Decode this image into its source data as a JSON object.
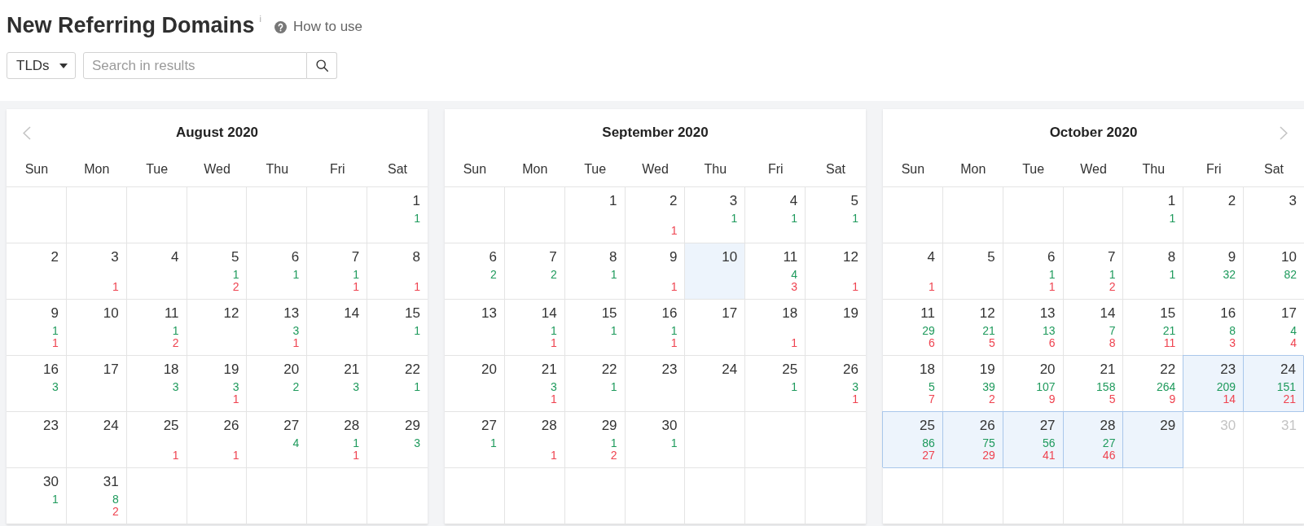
{
  "header": {
    "title": "New Referring Domains",
    "info_mark": "i",
    "help_link": "How to use"
  },
  "toolbar": {
    "filter_dropdown": "TLDs",
    "search": {
      "placeholder": "Search in results"
    }
  },
  "months": [
    {
      "title": "August 2020",
      "prev_arrow": true,
      "next_arrow": false,
      "weekdays": [
        "Sun",
        "Mon",
        "Tue",
        "Wed",
        "Thu",
        "Fri",
        "Sat"
      ],
      "weeks": [
        [
          {
            "kind": "blank"
          },
          {
            "kind": "blank"
          },
          {
            "kind": "blank"
          },
          {
            "kind": "blank"
          },
          {
            "kind": "blank"
          },
          {
            "kind": "blank"
          },
          {
            "kind": "day",
            "day": "1",
            "new": "1",
            "selected": false,
            "highlighted": false,
            "disabled": false
          }
        ],
        [
          {
            "kind": "day",
            "day": "2",
            "selected": false,
            "highlighted": false,
            "disabled": false
          },
          {
            "kind": "day",
            "day": "3",
            "lost": "1",
            "selected": false,
            "highlighted": false,
            "disabled": false
          },
          {
            "kind": "day",
            "day": "4",
            "selected": false,
            "highlighted": false,
            "disabled": false
          },
          {
            "kind": "day",
            "day": "5",
            "new": "1",
            "lost": "2",
            "selected": false,
            "highlighted": false,
            "disabled": false
          },
          {
            "kind": "day",
            "day": "6",
            "new": "1",
            "selected": false,
            "highlighted": false,
            "disabled": false
          },
          {
            "kind": "day",
            "day": "7",
            "new": "1",
            "lost": "1",
            "selected": false,
            "highlighted": false,
            "disabled": false
          },
          {
            "kind": "day",
            "day": "8",
            "lost": "1",
            "selected": false,
            "highlighted": false,
            "disabled": false
          }
        ],
        [
          {
            "kind": "day",
            "day": "9",
            "new": "1",
            "lost": "1",
            "selected": false,
            "highlighted": false,
            "disabled": false
          },
          {
            "kind": "day",
            "day": "10",
            "selected": false,
            "highlighted": false,
            "disabled": false
          },
          {
            "kind": "day",
            "day": "11",
            "new": "1",
            "lost": "2",
            "selected": false,
            "highlighted": false,
            "disabled": false
          },
          {
            "kind": "day",
            "day": "12",
            "selected": false,
            "highlighted": false,
            "disabled": false
          },
          {
            "kind": "day",
            "day": "13",
            "new": "3",
            "lost": "1",
            "selected": false,
            "highlighted": false,
            "disabled": false
          },
          {
            "kind": "day",
            "day": "14",
            "selected": false,
            "highlighted": false,
            "disabled": false
          },
          {
            "kind": "day",
            "day": "15",
            "new": "1",
            "selected": false,
            "highlighted": false,
            "disabled": false
          }
        ],
        [
          {
            "kind": "day",
            "day": "16",
            "new": "3",
            "selected": false,
            "highlighted": false,
            "disabled": false
          },
          {
            "kind": "day",
            "day": "17",
            "selected": false,
            "highlighted": false,
            "disabled": false
          },
          {
            "kind": "day",
            "day": "18",
            "new": "3",
            "selected": false,
            "highlighted": false,
            "disabled": false
          },
          {
            "kind": "day",
            "day": "19",
            "new": "3",
            "lost": "1",
            "selected": false,
            "highlighted": false,
            "disabled": false
          },
          {
            "kind": "day",
            "day": "20",
            "new": "2",
            "selected": false,
            "highlighted": false,
            "disabled": false
          },
          {
            "kind": "day",
            "day": "21",
            "new": "3",
            "selected": false,
            "highlighted": false,
            "disabled": false
          },
          {
            "kind": "day",
            "day": "22",
            "new": "1",
            "selected": false,
            "highlighted": false,
            "disabled": false
          }
        ],
        [
          {
            "kind": "day",
            "day": "23",
            "selected": false,
            "highlighted": false,
            "disabled": false
          },
          {
            "kind": "day",
            "day": "24",
            "selected": false,
            "highlighted": false,
            "disabled": false
          },
          {
            "kind": "day",
            "day": "25",
            "lost": "1",
            "selected": false,
            "highlighted": false,
            "disabled": false
          },
          {
            "kind": "day",
            "day": "26",
            "lost": "1",
            "selected": false,
            "highlighted": false,
            "disabled": false
          },
          {
            "kind": "day",
            "day": "27",
            "new": "4",
            "selected": false,
            "highlighted": false,
            "disabled": false
          },
          {
            "kind": "day",
            "day": "28",
            "new": "1",
            "lost": "1",
            "selected": false,
            "highlighted": false,
            "disabled": false
          },
          {
            "kind": "day",
            "day": "29",
            "new": "3",
            "selected": false,
            "highlighted": false,
            "disabled": false
          }
        ],
        [
          {
            "kind": "day",
            "day": "30",
            "new": "1",
            "selected": false,
            "highlighted": false,
            "disabled": false
          },
          {
            "kind": "day",
            "day": "31",
            "new": "8",
            "lost": "2",
            "selected": false,
            "highlighted": false,
            "disabled": false
          },
          {
            "kind": "blank"
          },
          {
            "kind": "blank"
          },
          {
            "kind": "blank"
          },
          {
            "kind": "blank"
          },
          {
            "kind": "blank"
          }
        ]
      ]
    },
    {
      "title": "September 2020",
      "prev_arrow": false,
      "next_arrow": false,
      "weekdays": [
        "Sun",
        "Mon",
        "Tue",
        "Wed",
        "Thu",
        "Fri",
        "Sat"
      ],
      "weeks": [
        [
          {
            "kind": "blank"
          },
          {
            "kind": "blank"
          },
          {
            "kind": "day",
            "day": "1",
            "selected": false,
            "highlighted": false,
            "disabled": false
          },
          {
            "kind": "day",
            "day": "2",
            "lost": "1",
            "selected": false,
            "highlighted": false,
            "disabled": false
          },
          {
            "kind": "day",
            "day": "3",
            "new": "1",
            "selected": false,
            "highlighted": false,
            "disabled": false
          },
          {
            "kind": "day",
            "day": "4",
            "new": "1",
            "selected": false,
            "highlighted": false,
            "disabled": false
          },
          {
            "kind": "day",
            "day": "5",
            "new": "1",
            "selected": false,
            "highlighted": false,
            "disabled": false
          }
        ],
        [
          {
            "kind": "day",
            "day": "6",
            "new": "2",
            "selected": false,
            "highlighted": false,
            "disabled": false
          },
          {
            "kind": "day",
            "day": "7",
            "new": "2",
            "selected": false,
            "highlighted": false,
            "disabled": false
          },
          {
            "kind": "day",
            "day": "8",
            "new": "1",
            "selected": false,
            "highlighted": false,
            "disabled": false
          },
          {
            "kind": "day",
            "day": "9",
            "lost": "1",
            "selected": false,
            "highlighted": false,
            "disabled": false
          },
          {
            "kind": "day",
            "day": "10",
            "selected": false,
            "highlighted": true,
            "disabled": false
          },
          {
            "kind": "day",
            "day": "11",
            "new": "4",
            "lost": "3",
            "selected": false,
            "highlighted": false,
            "disabled": false
          },
          {
            "kind": "day",
            "day": "12",
            "lost": "1",
            "selected": false,
            "highlighted": false,
            "disabled": false
          }
        ],
        [
          {
            "kind": "day",
            "day": "13",
            "selected": false,
            "highlighted": false,
            "disabled": false
          },
          {
            "kind": "day",
            "day": "14",
            "new": "1",
            "lost": "1",
            "selected": false,
            "highlighted": false,
            "disabled": false
          },
          {
            "kind": "day",
            "day": "15",
            "new": "1",
            "selected": false,
            "highlighted": false,
            "disabled": false
          },
          {
            "kind": "day",
            "day": "16",
            "new": "1",
            "lost": "1",
            "selected": false,
            "highlighted": false,
            "disabled": false
          },
          {
            "kind": "day",
            "day": "17",
            "selected": false,
            "highlighted": false,
            "disabled": false
          },
          {
            "kind": "day",
            "day": "18",
            "lost": "1",
            "selected": false,
            "highlighted": false,
            "disabled": false
          },
          {
            "kind": "day",
            "day": "19",
            "selected": false,
            "highlighted": false,
            "disabled": false
          }
        ],
        [
          {
            "kind": "day",
            "day": "20",
            "selected": false,
            "highlighted": false,
            "disabled": false
          },
          {
            "kind": "day",
            "day": "21",
            "new": "3",
            "lost": "1",
            "selected": false,
            "highlighted": false,
            "disabled": false
          },
          {
            "kind": "day",
            "day": "22",
            "new": "1",
            "selected": false,
            "highlighted": false,
            "disabled": false
          },
          {
            "kind": "day",
            "day": "23",
            "selected": false,
            "highlighted": false,
            "disabled": false
          },
          {
            "kind": "day",
            "day": "24",
            "selected": false,
            "highlighted": false,
            "disabled": false
          },
          {
            "kind": "day",
            "day": "25",
            "new": "1",
            "selected": false,
            "highlighted": false,
            "disabled": false
          },
          {
            "kind": "day",
            "day": "26",
            "new": "3",
            "lost": "1",
            "selected": false,
            "highlighted": false,
            "disabled": false
          }
        ],
        [
          {
            "kind": "day",
            "day": "27",
            "new": "1",
            "selected": false,
            "highlighted": false,
            "disabled": false
          },
          {
            "kind": "day",
            "day": "28",
            "lost": "1",
            "selected": false,
            "highlighted": false,
            "disabled": false
          },
          {
            "kind": "day",
            "day": "29",
            "new": "1",
            "lost": "2",
            "selected": false,
            "highlighted": false,
            "disabled": false
          },
          {
            "kind": "day",
            "day": "30",
            "new": "1",
            "selected": false,
            "highlighted": false,
            "disabled": false
          },
          {
            "kind": "blank"
          },
          {
            "kind": "blank"
          },
          {
            "kind": "blank"
          }
        ],
        [
          {
            "kind": "blank"
          },
          {
            "kind": "blank"
          },
          {
            "kind": "blank"
          },
          {
            "kind": "blank"
          },
          {
            "kind": "blank"
          },
          {
            "kind": "blank"
          },
          {
            "kind": "blank"
          }
        ]
      ]
    },
    {
      "title": "October 2020",
      "prev_arrow": false,
      "next_arrow": true,
      "weekdays": [
        "Sun",
        "Mon",
        "Tue",
        "Wed",
        "Thu",
        "Fri",
        "Sat"
      ],
      "weeks": [
        [
          {
            "kind": "blank"
          },
          {
            "kind": "blank"
          },
          {
            "kind": "blank"
          },
          {
            "kind": "blank"
          },
          {
            "kind": "day",
            "day": "1",
            "new": "1",
            "selected": false,
            "highlighted": false,
            "disabled": false
          },
          {
            "kind": "day",
            "day": "2",
            "selected": false,
            "highlighted": false,
            "disabled": false
          },
          {
            "kind": "day",
            "day": "3",
            "selected": false,
            "highlighted": false,
            "disabled": false
          }
        ],
        [
          {
            "kind": "day",
            "day": "4",
            "lost": "1",
            "selected": false,
            "highlighted": false,
            "disabled": false
          },
          {
            "kind": "day",
            "day": "5",
            "selected": false,
            "highlighted": false,
            "disabled": false
          },
          {
            "kind": "day",
            "day": "6",
            "new": "1",
            "lost": "1",
            "selected": false,
            "highlighted": false,
            "disabled": false
          },
          {
            "kind": "day",
            "day": "7",
            "new": "1",
            "lost": "2",
            "selected": false,
            "highlighted": false,
            "disabled": false
          },
          {
            "kind": "day",
            "day": "8",
            "new": "1",
            "selected": false,
            "highlighted": false,
            "disabled": false
          },
          {
            "kind": "day",
            "day": "9",
            "new": "32",
            "selected": false,
            "highlighted": false,
            "disabled": false
          },
          {
            "kind": "day",
            "day": "10",
            "new": "82",
            "selected": false,
            "highlighted": false,
            "disabled": false
          }
        ],
        [
          {
            "kind": "day",
            "day": "11",
            "new": "29",
            "lost": "6",
            "selected": false,
            "highlighted": false,
            "disabled": false
          },
          {
            "kind": "day",
            "day": "12",
            "new": "21",
            "lost": "5",
            "selected": false,
            "highlighted": false,
            "disabled": false
          },
          {
            "kind": "day",
            "day": "13",
            "new": "13",
            "lost": "6",
            "selected": false,
            "highlighted": false,
            "disabled": false
          },
          {
            "kind": "day",
            "day": "14",
            "new": "7",
            "lost": "8",
            "selected": false,
            "highlighted": false,
            "disabled": false
          },
          {
            "kind": "day",
            "day": "15",
            "new": "21",
            "lost": "11",
            "selected": false,
            "highlighted": false,
            "disabled": false
          },
          {
            "kind": "day",
            "day": "16",
            "new": "8",
            "lost": "3",
            "selected": false,
            "highlighted": false,
            "disabled": false
          },
          {
            "kind": "day",
            "day": "17",
            "new": "4",
            "lost": "4",
            "selected": false,
            "highlighted": false,
            "disabled": false
          }
        ],
        [
          {
            "kind": "day",
            "day": "18",
            "new": "5",
            "lost": "7",
            "selected": false,
            "highlighted": false,
            "disabled": false
          },
          {
            "kind": "day",
            "day": "19",
            "new": "39",
            "lost": "2",
            "selected": false,
            "highlighted": false,
            "disabled": false
          },
          {
            "kind": "day",
            "day": "20",
            "new": "107",
            "lost": "9",
            "selected": false,
            "highlighted": false,
            "disabled": false
          },
          {
            "kind": "day",
            "day": "21",
            "new": "158",
            "lost": "5",
            "selected": false,
            "highlighted": false,
            "disabled": false
          },
          {
            "kind": "day",
            "day": "22",
            "new": "264",
            "lost": "9",
            "selected": false,
            "highlighted": false,
            "disabled": false
          },
          {
            "kind": "day",
            "day": "23",
            "new": "209",
            "lost": "14",
            "selected": true,
            "highlighted": false,
            "disabled": false
          },
          {
            "kind": "day",
            "day": "24",
            "new": "151",
            "lost": "21",
            "selected": true,
            "highlighted": false,
            "disabled": false
          }
        ],
        [
          {
            "kind": "day",
            "day": "25",
            "new": "86",
            "lost": "27",
            "selected": true,
            "highlighted": false,
            "disabled": false
          },
          {
            "kind": "day",
            "day": "26",
            "new": "75",
            "lost": "29",
            "selected": true,
            "highlighted": false,
            "disabled": false
          },
          {
            "kind": "day",
            "day": "27",
            "new": "56",
            "lost": "41",
            "selected": true,
            "highlighted": false,
            "disabled": false
          },
          {
            "kind": "day",
            "day": "28",
            "new": "27",
            "lost": "46",
            "selected": true,
            "highlighted": false,
            "disabled": false
          },
          {
            "kind": "day",
            "day": "29",
            "selected": true,
            "highlighted": false,
            "disabled": false
          },
          {
            "kind": "day",
            "day": "30",
            "selected": false,
            "highlighted": false,
            "disabled": true
          },
          {
            "kind": "day",
            "day": "31",
            "selected": false,
            "highlighted": false,
            "disabled": true
          }
        ],
        [
          {
            "kind": "blank"
          },
          {
            "kind": "blank"
          },
          {
            "kind": "blank"
          },
          {
            "kind": "blank"
          },
          {
            "kind": "blank"
          },
          {
            "kind": "blank"
          },
          {
            "kind": "blank"
          }
        ]
      ]
    }
  ]
}
